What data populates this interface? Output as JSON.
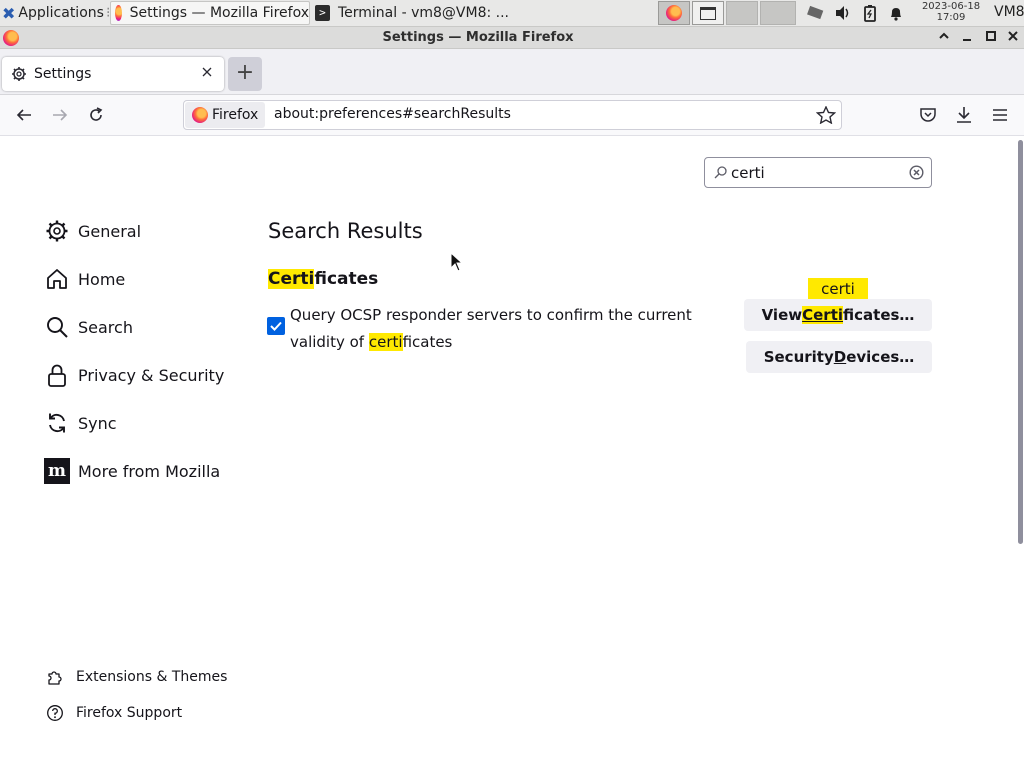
{
  "panel": {
    "applications_label": "Applications",
    "tasks": [
      {
        "label": "Settings — Mozilla Firefox"
      },
      {
        "label": "Terminal - vm8@VM8: ..."
      }
    ],
    "clock_date": "2023-06-18",
    "clock_time": "17:09",
    "user": "VM8"
  },
  "window": {
    "title": "Settings — Mozilla Firefox"
  },
  "tab": {
    "label": "Settings",
    "new_tab_label": "+"
  },
  "urlbar": {
    "identity_label": "Firefox",
    "url": "about:preferences#searchResults"
  },
  "search": {
    "value": "certi"
  },
  "sidebar": {
    "items": [
      {
        "label": "General",
        "icon": "gear-icon"
      },
      {
        "label": "Home",
        "icon": "home-icon"
      },
      {
        "label": "Search",
        "icon": "search-icon"
      },
      {
        "label": "Privacy & Security",
        "icon": "lock-icon"
      },
      {
        "label": "Sync",
        "icon": "sync-icon"
      },
      {
        "label": "More from Mozilla",
        "icon": "mozilla-icon"
      }
    ],
    "footer": [
      {
        "label": "Extensions & Themes",
        "icon": "puzzle-icon"
      },
      {
        "label": "Firefox Support",
        "icon": "help-icon"
      }
    ]
  },
  "results": {
    "heading": "Search Results",
    "section": {
      "title_hl": "Certi",
      "title_rest": "ficates"
    },
    "ocsp": {
      "checked": true,
      "line1": "Query OCSP responder servers to confirm the current",
      "line2_pre": "validity of ",
      "line2_hl": "certi",
      "line2_post": "ficates"
    },
    "tooltip": "certi",
    "view_button": {
      "pre": "View ",
      "hl": "Certi",
      "post": "ficates…"
    },
    "devices_button": {
      "pre": "Security ",
      "accesskey": "D",
      "post": "evices…"
    }
  },
  "colors": {
    "highlight": "#ffe900",
    "checkbox": "#0061e0",
    "accent_text": "#15141a"
  }
}
